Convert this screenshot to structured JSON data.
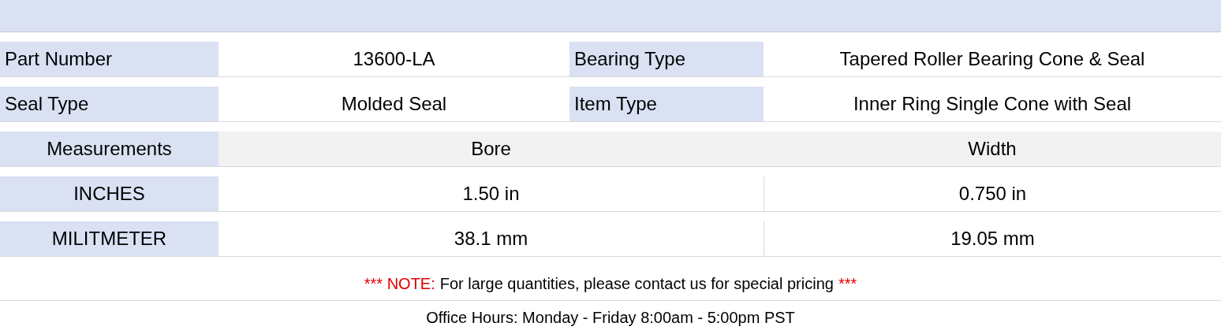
{
  "specs": [
    {
      "pairs": [
        {
          "label": "Part Number",
          "value": "13600-LA"
        },
        {
          "label": "Bearing Type",
          "value": "Tapered Roller Bearing Cone & Seal"
        }
      ]
    },
    {
      "pairs": [
        {
          "label": "Seal Type",
          "value": "Molded Seal"
        },
        {
          "label": "Item Type",
          "value": "Inner Ring Single Cone with Seal"
        }
      ]
    }
  ],
  "measurements": {
    "heading": "Measurements",
    "columns": [
      "Bore",
      "Width"
    ],
    "rows": [
      {
        "unit": "INCHES",
        "values": [
          "1.50 in",
          "0.750 in"
        ]
      },
      {
        "unit": "MILITMETER",
        "values": [
          "38.1 mm",
          "19.05 mm"
        ]
      }
    ]
  },
  "note": {
    "prefix": "*** NOTE:",
    "text": "For large quantities, please contact us for special pricing",
    "suffix": "***"
  },
  "office_hours": "Office Hours: Monday - Friday 8:00am - 5:00pm PST"
}
